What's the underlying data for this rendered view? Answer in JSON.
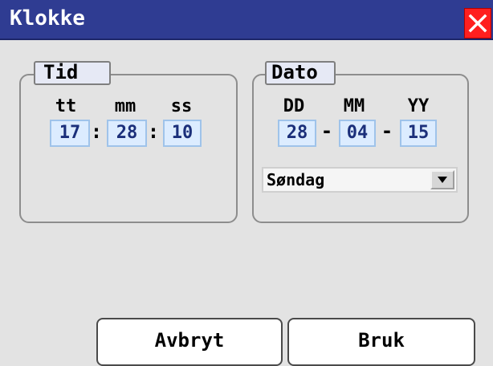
{
  "window": {
    "title": "Klokke",
    "close_icon": "close-icon"
  },
  "time_group": {
    "legend": "Tid",
    "labels": {
      "hours": "tt",
      "minutes": "mm",
      "seconds": "ss"
    },
    "values": {
      "hours": "17",
      "minutes": "28",
      "seconds": "10"
    },
    "separator": ":"
  },
  "date_group": {
    "legend": "Dato",
    "labels": {
      "day": "DD",
      "month": "MM",
      "year": "YY"
    },
    "values": {
      "day": "28",
      "month": "04",
      "year": "15"
    },
    "separator": "-",
    "weekday": {
      "selected": "Søndag",
      "arrow_icon": "dropdown-arrow-icon"
    }
  },
  "buttons": {
    "cancel": "Avbryt",
    "apply": "Bruk"
  },
  "colors": {
    "titlebar": "#2f3c92",
    "close_button": "#ff1f1f",
    "field_background": "#dcecff",
    "field_text": "#1b2f7a",
    "background": "#e3e3e3"
  }
}
